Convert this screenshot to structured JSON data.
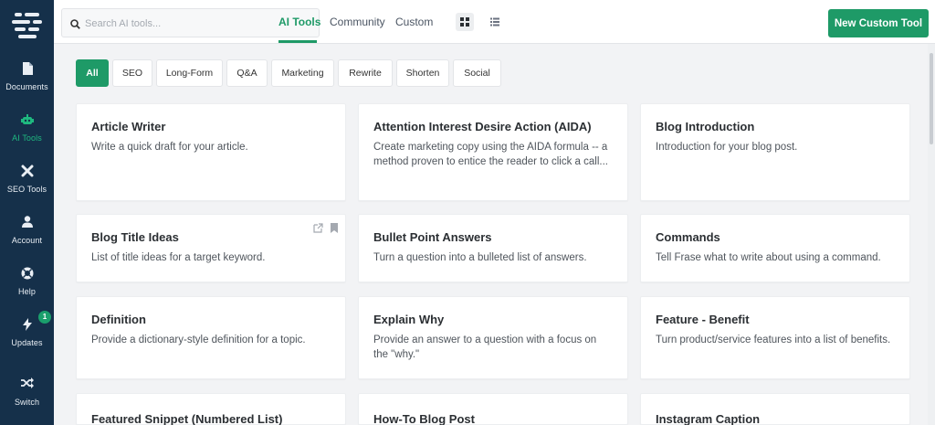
{
  "sidebar": {
    "items": [
      {
        "label": "Documents",
        "icon": "document-icon"
      },
      {
        "label": "AI Tools",
        "icon": "robot-icon"
      },
      {
        "label": "SEO Tools",
        "icon": "tools-icon"
      },
      {
        "label": "Account",
        "icon": "user-icon"
      },
      {
        "label": "Help",
        "icon": "help-icon"
      },
      {
        "label": "Updates",
        "icon": "bolt-icon",
        "badge": "1"
      },
      {
        "label": "Switch",
        "icon": "shuffle-icon"
      }
    ]
  },
  "topbar": {
    "search_placeholder": "Search AI tools...",
    "tabs": [
      "AI Tools",
      "Community",
      "Custom"
    ],
    "new_button": "New Custom Tool"
  },
  "filters": [
    "All",
    "SEO",
    "Long-Form",
    "Q&A",
    "Marketing",
    "Rewrite",
    "Shorten",
    "Social"
  ],
  "cards": [
    {
      "title": "Article Writer",
      "desc": "Write a quick draft for your article."
    },
    {
      "title": "Attention Interest Desire Action (AIDA)",
      "desc": "Create marketing copy using the AIDA formula -- a method proven to entice the reader to click a call..."
    },
    {
      "title": "Blog Introduction",
      "desc": "Introduction for your blog post."
    },
    {
      "title": "Blog Title Ideas",
      "desc": "List of title ideas for a target keyword."
    },
    {
      "title": "Bullet Point Answers",
      "desc": "Turn a question into a bulleted list of answers."
    },
    {
      "title": "Commands",
      "desc": "Tell Frase what to write about using a command."
    },
    {
      "title": "Definition",
      "desc": "Provide a dictionary-style definition for a topic."
    },
    {
      "title": "Explain Why",
      "desc": "Provide an answer to a question with a focus on the \"why.\""
    },
    {
      "title": "Feature - Benefit",
      "desc": "Turn product/service features into a list of benefits."
    },
    {
      "title": "Featured Snippet (Numbered List)",
      "desc": ""
    },
    {
      "title": "How-To Blog Post",
      "desc": ""
    },
    {
      "title": "Instagram Caption",
      "desc": ""
    }
  ],
  "colors": {
    "accent": "#1e9a67",
    "sidebar_bg": "#15304a",
    "page_bg": "#f2f3f5"
  }
}
